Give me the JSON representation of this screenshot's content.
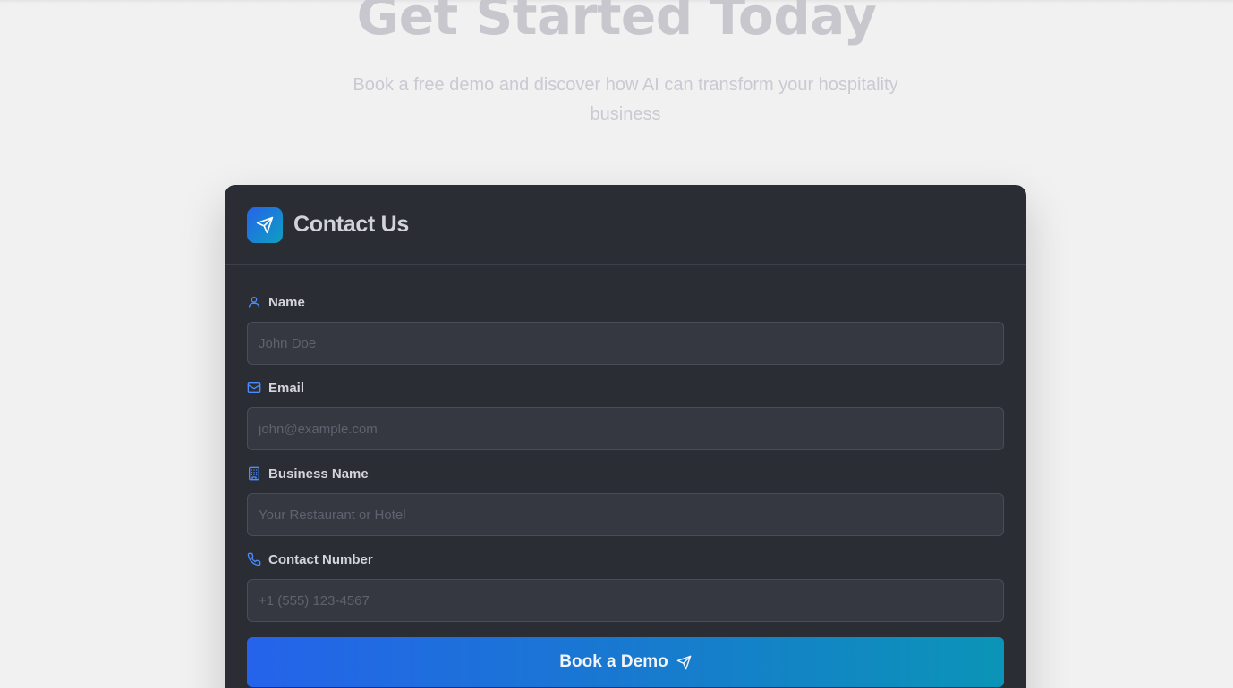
{
  "hero": {
    "title": "Get Started Today",
    "subtitle": "Book a free demo and discover how AI can transform your hospitality business"
  },
  "card": {
    "title": "Contact Us",
    "header_icon": "send-icon",
    "fields": [
      {
        "label": "Name",
        "icon": "user-icon",
        "placeholder": "John Doe"
      },
      {
        "label": "Email",
        "icon": "mail-icon",
        "placeholder": "john@example.com"
      },
      {
        "label": "Business Name",
        "icon": "building-icon",
        "placeholder": "Your Restaurant or Hotel"
      },
      {
        "label": "Contact Number",
        "icon": "phone-icon",
        "placeholder": "+1 (555) 123-4567"
      }
    ],
    "submit_label": "Book a Demo",
    "submit_icon": "send-icon"
  },
  "colors": {
    "accent_start": "#2563eb",
    "accent_end": "#0b94b7",
    "card_bg": "#2b2d35",
    "icon_blue": "#4a8dff"
  }
}
